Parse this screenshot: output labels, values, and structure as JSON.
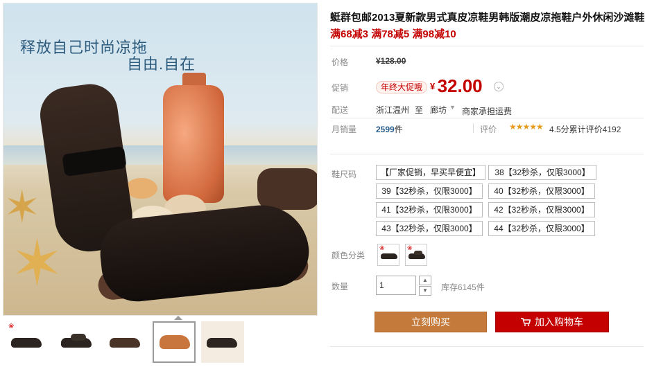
{
  "hero": {
    "slogan_line1": "释放自己时尚凉拖",
    "slogan_line2": "自由.自在"
  },
  "product": {
    "title": "蜓群包邮2013夏新款男式真皮凉鞋男韩版潮皮凉拖鞋户外休闲沙滩鞋",
    "promo": "满68减3 满78减5 满98减10"
  },
  "price": {
    "label": "价格",
    "original": "¥128.00",
    "currency": "¥"
  },
  "promotion": {
    "label": "促销",
    "tag": "年终大促哦",
    "currency": "¥",
    "price": "32.00"
  },
  "shipping": {
    "label": "配送",
    "from": "浙江温州",
    "to_word": "至",
    "destination": "廊坊",
    "fee": "商家承担运费"
  },
  "sales": {
    "label": "月销量",
    "count": "2599",
    "unit": "件",
    "rating_label": "评价",
    "stars": "★★★★★",
    "rating_text": "4.5分累计评价4192"
  },
  "sizes": {
    "label": "鞋尺码",
    "options": [
      "【厂家促销，早买早便宜】",
      "38【32秒杀，仅限3000】",
      "39【32秒杀，仅限3000】",
      "40【32秒杀，仅限3000】",
      "41【32秒杀，仅限3000】",
      "42【32秒杀，仅限3000】",
      "43【32秒杀，仅限3000】",
      "44【32秒杀，仅限3000】"
    ]
  },
  "colors": {
    "label": "颜色分类"
  },
  "quantity": {
    "label": "数量",
    "value": "1",
    "stock": "库存6145件"
  },
  "actions": {
    "buy_now": "立刻购买",
    "add_to_cart": "加入购物车"
  },
  "colors_theme": {
    "accent_red": "#c40000",
    "buy_orange": "#c47a3a"
  }
}
